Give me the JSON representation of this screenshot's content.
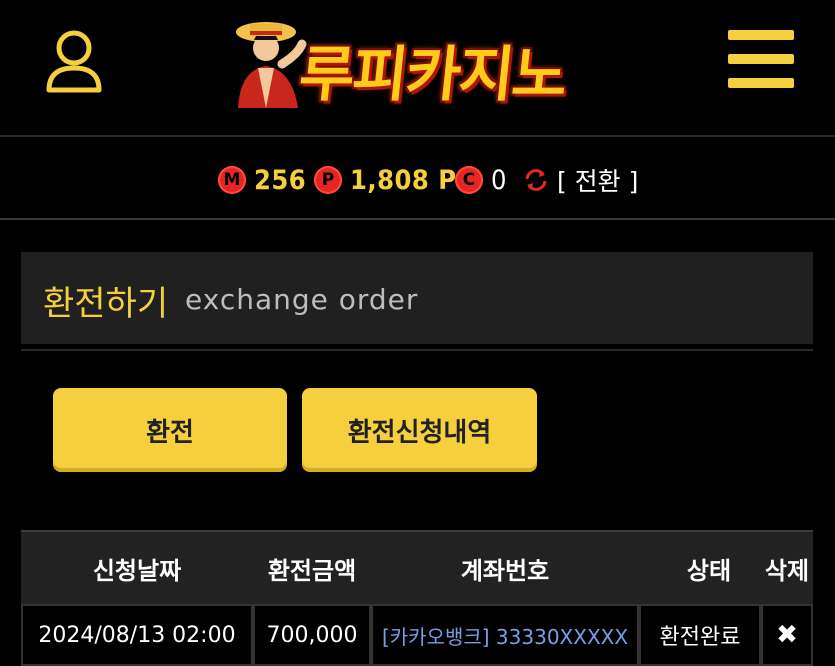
{
  "header": {
    "logo_text": "루피카지노",
    "user_icon": "user-icon",
    "menu_icon": "hamburger-menu-icon"
  },
  "points": {
    "m_label": "M",
    "m_value": "256",
    "p_label": "P",
    "p_value": "1,808 P",
    "c_label": "C",
    "c_value": "0",
    "refresh_icon": "refresh-icon",
    "convert_label": "[ 전환 ]",
    "coin_color": "#e52622",
    "accent_color": "#f6cf3f"
  },
  "page": {
    "title_ko": "환전하기",
    "title_en": "exchange order"
  },
  "buttons": {
    "exchange": "환전",
    "history": "환전신청내역"
  },
  "table": {
    "headers": [
      "신청날짜",
      "환전금액",
      "계좌번호",
      "상태",
      "삭제"
    ],
    "rows": [
      {
        "date": "2024/08/13 02:00",
        "amount": "700,000",
        "account": "[카카오뱅크] 33330XXXXX",
        "status": "환전완료",
        "delete": "✖"
      }
    ]
  }
}
